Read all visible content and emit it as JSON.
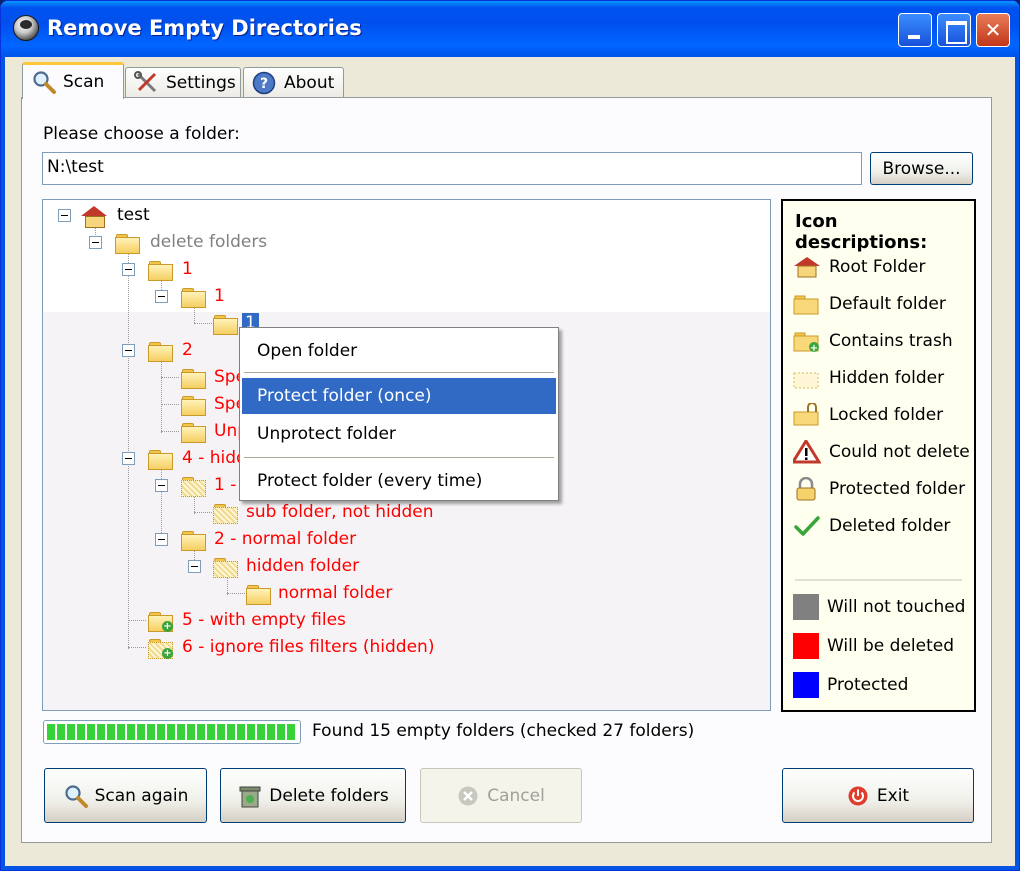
{
  "window": {
    "title": "Remove Empty Directories"
  },
  "tabs": [
    {
      "label": "Scan",
      "icon": "magnifier-icon",
      "active": true
    },
    {
      "label": "Settings",
      "icon": "tools-icon",
      "active": false
    },
    {
      "label": "About",
      "icon": "help-icon",
      "active": false
    }
  ],
  "scan": {
    "folder_prompt": "Please choose a folder:",
    "folder_value": "N:\\test",
    "browse_label": "Browse..."
  },
  "tree": {
    "nodes": [
      {
        "label": "test"
      },
      {
        "label": "delete folders"
      },
      {
        "label": "1"
      },
      {
        "label": "1"
      },
      {
        "label": "1"
      },
      {
        "label": "2"
      },
      {
        "label": "Spe"
      },
      {
        "label": "Spe"
      },
      {
        "label": "Unp"
      },
      {
        "label": "4 - hidde"
      },
      {
        "label": "1 - "
      },
      {
        "label": "sub folder, not hidden"
      },
      {
        "label": "2 - normal folder"
      },
      {
        "label": "hidden folder"
      },
      {
        "label": "normal folder"
      },
      {
        "label": "5 - with empty files"
      },
      {
        "label": "6 - ignore files filters (hidden)"
      }
    ]
  },
  "context_menu": {
    "items": [
      "Open folder",
      "Protect folder (once)",
      "Unprotect folder",
      "Protect folder (every time)"
    ],
    "highlighted_index": 1
  },
  "legend": {
    "title": "Icon descriptions:",
    "icons": [
      "Root Folder",
      "Default folder",
      "Contains trash",
      "Hidden folder",
      "Locked folder",
      "Could not delete",
      "Protected folder",
      "Deleted folder"
    ],
    "colors": [
      {
        "label": "Will not touched",
        "color": "#808080"
      },
      {
        "label": "Will be deleted",
        "color": "#ff0000"
      },
      {
        "label": "Protected",
        "color": "#0000ff"
      }
    ]
  },
  "status": {
    "progress": 1.0,
    "text": "Found 15 empty folders (checked 27 folders)"
  },
  "buttons": {
    "scan_again": "Scan again",
    "delete_folders": "Delete folders",
    "cancel": "Cancel",
    "exit": "Exit"
  }
}
